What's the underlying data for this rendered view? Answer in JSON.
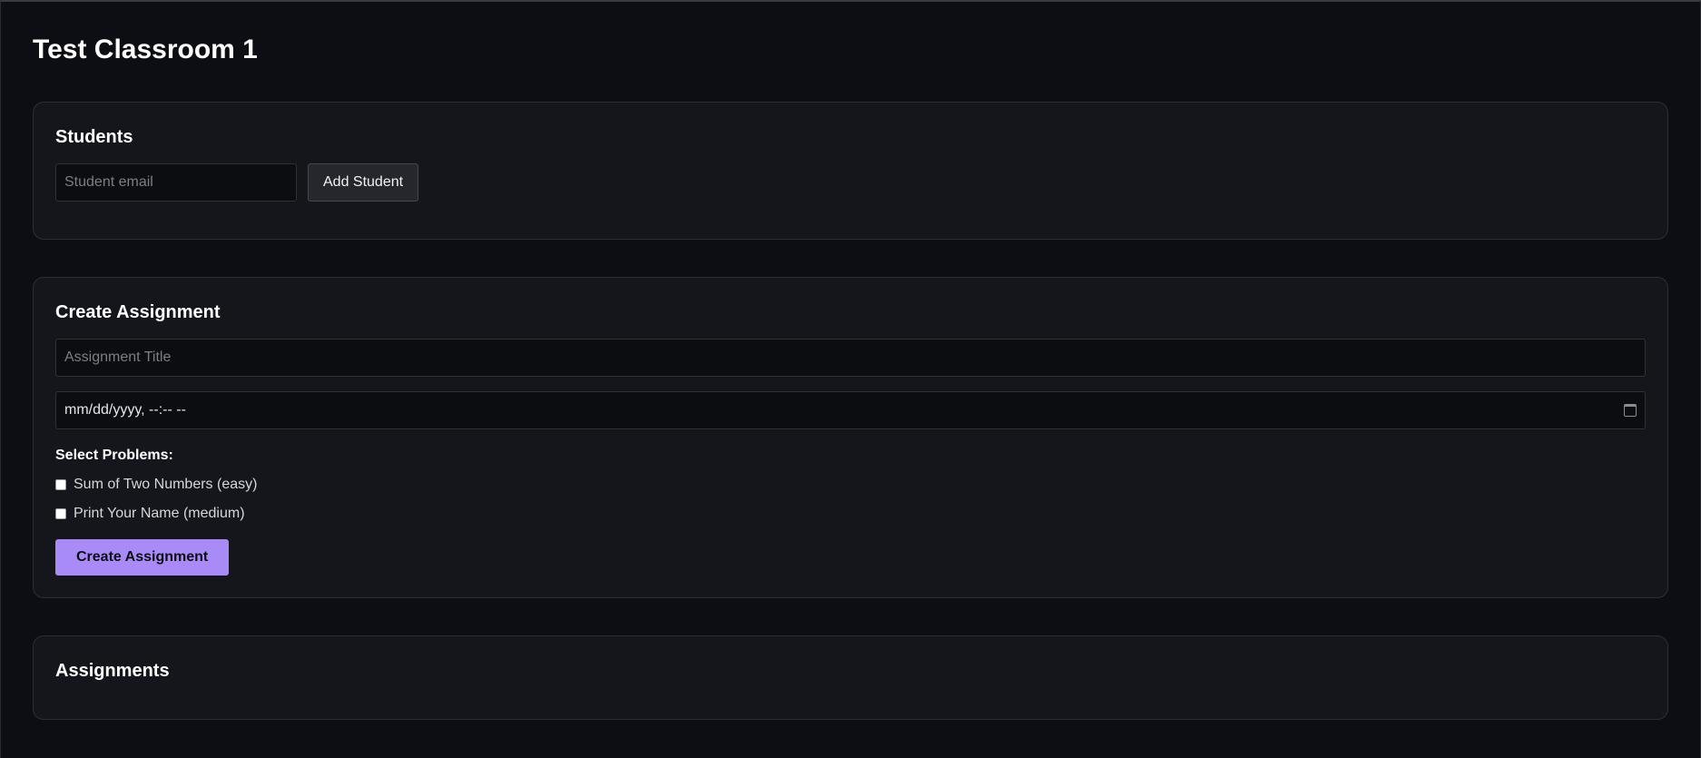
{
  "page": {
    "title": "Test Classroom 1"
  },
  "students": {
    "title": "Students",
    "email_placeholder": "Student email",
    "add_button_label": "Add Student"
  },
  "create_assignment": {
    "title": "Create Assignment",
    "title_placeholder": "Assignment Title",
    "datetime_placeholder": "mm/dd/yyyy, --:-- --",
    "select_problems_label": "Select Problems:",
    "problems": [
      {
        "label": "Sum of Two Numbers (easy)",
        "checked": false
      },
      {
        "label": "Print Your Name (medium)",
        "checked": false
      }
    ],
    "submit_label": "Create Assignment"
  },
  "assignments": {
    "title": "Assignments"
  },
  "icons": {
    "datetime_picker": "calendar-icon"
  },
  "colors": {
    "background": "#0d0e14",
    "card": "#14161b",
    "accent": "#a98bf7"
  }
}
